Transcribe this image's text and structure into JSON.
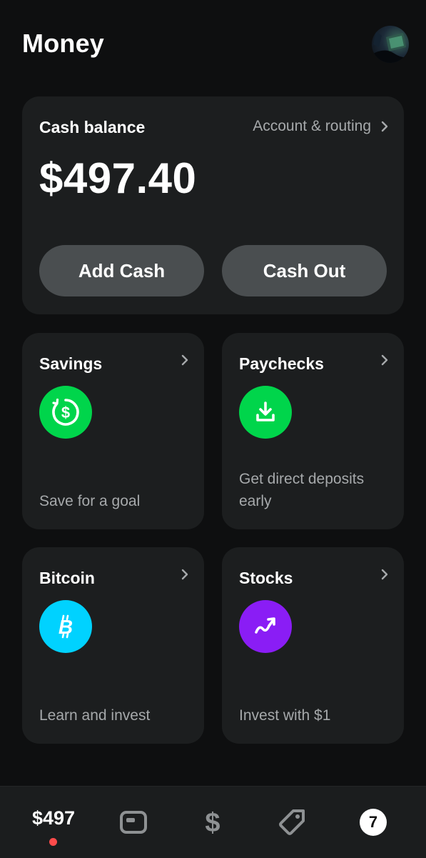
{
  "header": {
    "title": "Money"
  },
  "balance_card": {
    "label": "Cash balance",
    "account_link": "Account & routing",
    "amount": "$497.40",
    "add_cash_label": "Add Cash",
    "cash_out_label": "Cash Out"
  },
  "tiles": [
    {
      "title": "Savings",
      "description": "Save for a goal",
      "icon": "dollar-circle-icon",
      "color": "#00d54b"
    },
    {
      "title": "Paychecks",
      "description": "Get direct deposits early",
      "icon": "download-tray-icon",
      "color": "#00d54b"
    },
    {
      "title": "Bitcoin",
      "description": "Learn and invest",
      "icon": "bitcoin-icon",
      "color": "#00d2ff"
    },
    {
      "title": "Stocks",
      "description": "Invest with $1",
      "icon": "trend-arrow-icon",
      "color": "#8a1df5"
    }
  ],
  "bottom_nav": {
    "balance": "$497",
    "items": [
      "money-tab",
      "card-tab",
      "pay-tab",
      "offers-tab",
      "activity-tab"
    ],
    "activity_badge": "7",
    "notification_dot_color": "#ff4b4b"
  },
  "colors": {
    "background": "#0e0f10",
    "card": "#1c1e1f",
    "button": "#4a4e50",
    "secondary_text": "#a6a9ab"
  }
}
